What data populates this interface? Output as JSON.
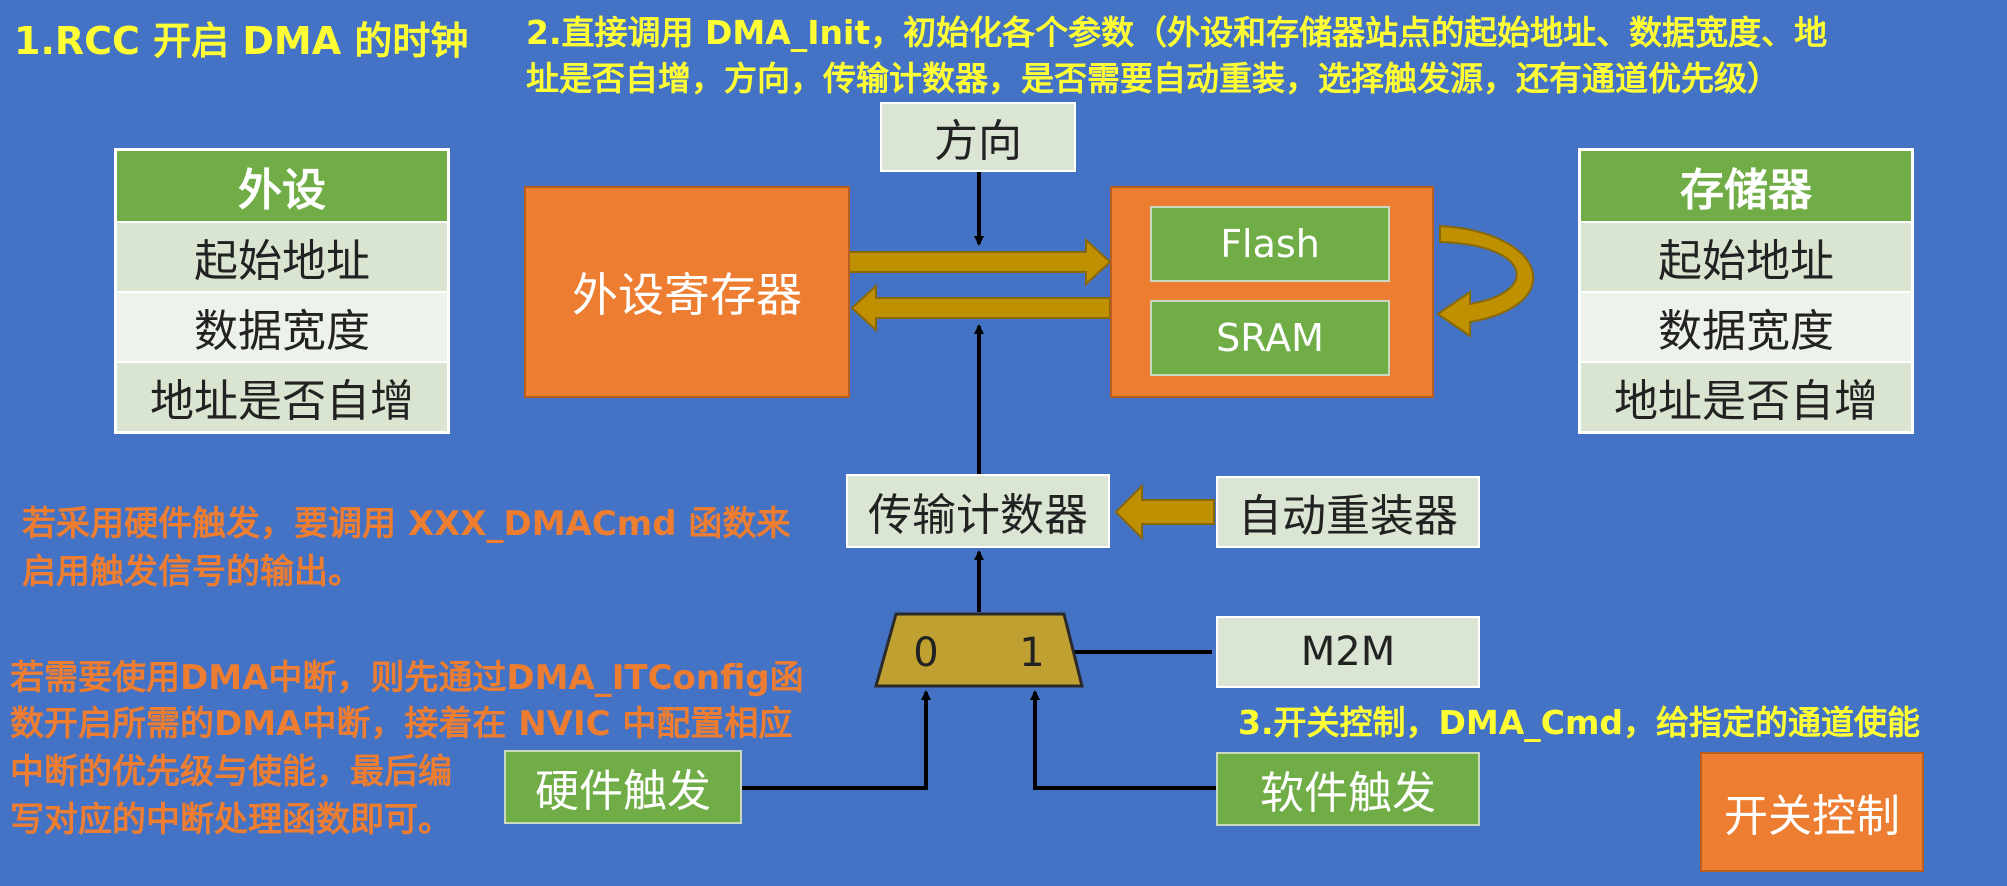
{
  "notes": {
    "step1": "1.RCC 开启 DMA 的时钟",
    "step2_line1": "2.直接调用 DMA_Init，初始化各个参数（外设和存储器站点的起始地址、数据宽度、地",
    "step2_line2": "址是否自增，方向，传输计数器，是否需要自动重装，选择触发源，还有通道优先级）",
    "step3": "3.开关控制，DMA_Cmd，给指定的通道使能",
    "hw_trigger_line1": "若采用硬件触发，要调用 XXX_DMACmd 函数来",
    "hw_trigger_line2": "启用触发信号的输出。",
    "irq_line1": "若需要使用DMA中断，则先通过DMA_ITConfig函",
    "irq_line2": "数开启所需的DMA中断，接着在 NVIC 中配置相应",
    "irq_line3": "中断的优先级与使能，最后编",
    "irq_line4": "写对应的中断处理函数即可。"
  },
  "peripheral_table": {
    "title": "外设",
    "rows": [
      "起始地址",
      "数据宽度",
      "地址是否自增"
    ]
  },
  "memory_table": {
    "title": "存储器",
    "rows": [
      "起始地址",
      "数据宽度",
      "地址是否自增"
    ]
  },
  "blocks": {
    "direction": "方向",
    "peripheral_register": "外设寄存器",
    "flash": "Flash",
    "sram": "SRAM",
    "transfer_counter": "传输计数器",
    "auto_reload": "自动重装器",
    "m2m": "M2M",
    "mux_0": "0",
    "mux_1": "1",
    "hardware_trigger": "硬件触发",
    "software_trigger": "软件触发",
    "switch_control": "开关控制"
  },
  "colors": {
    "background": "#4472c4",
    "note_yellow": "#ffff33",
    "note_orange": "#ed7d31",
    "block_orange": "#ed7d31",
    "block_green": "#70ad47",
    "block_light": "#dbe5d3",
    "arrow_gold": "#bf9000",
    "mux_gold": "#c0a030"
  }
}
